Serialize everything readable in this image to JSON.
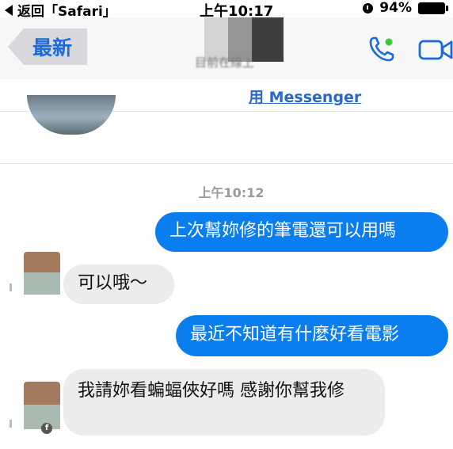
{
  "status_bar": {
    "back_label": "返回「Safari」",
    "time": "上午10:17",
    "battery": "94%"
  },
  "nav": {
    "back_button_label": "最新",
    "contact_subtitle": "目前在線上"
  },
  "messenger_link": "用 Messenger",
  "conversation": {
    "timestamp_prefix": "上午",
    "timestamp_time": "10:12",
    "messages": [
      {
        "side": "out",
        "text": "上次幫妳修的筆電還可以用嗎"
      },
      {
        "side": "in",
        "text": "可以哦～"
      },
      {
        "side": "out",
        "text": "最近不知道有什麼好看電影"
      },
      {
        "side": "in",
        "text": "我請妳看蝙蝠俠好嗎 感謝你幫我修"
      }
    ]
  },
  "icons": {
    "call": "phone-icon",
    "video": "video-camera-icon",
    "badge": "facebook-icon"
  },
  "colors": {
    "accent": "#1a6cd8",
    "outgoing_bubble": "#0b7eef",
    "incoming_bubble": "#ececec",
    "online_dot": "#33cc33"
  }
}
